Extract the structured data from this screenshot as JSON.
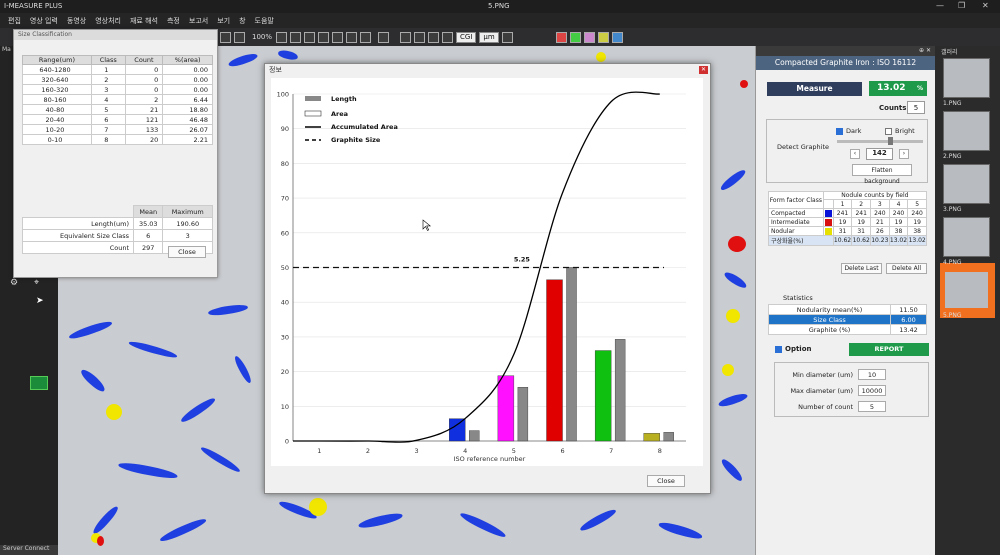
{
  "app": {
    "title": "I-MEASURE PLUS",
    "file": "5.PNG"
  },
  "menu": [
    "편집",
    "영상 입력",
    "동영상",
    "영상처리",
    "재료 해석",
    "측정",
    "보고서",
    "보기",
    "창",
    "도움말"
  ],
  "toolbar": {
    "zoom": "100%",
    "calib": "CGI",
    "unit": "μm"
  },
  "left": {
    "tab_partial": "Ma",
    "server": "Server Connect"
  },
  "size_dialog": {
    "title": "Size Classification",
    "headers": [
      "Range(um)",
      "Class",
      "Count",
      "%(area)"
    ],
    "rows": [
      [
        "640-1280",
        "1",
        "0",
        "0.00"
      ],
      [
        "320-640",
        "2",
        "0",
        "0.00"
      ],
      [
        "160-320",
        "3",
        "0",
        "0.00"
      ],
      [
        "80-160",
        "4",
        "2",
        "6.44"
      ],
      [
        "40-80",
        "5",
        "21",
        "18.80"
      ],
      [
        "20-40",
        "6",
        "121",
        "46.48"
      ],
      [
        "10-20",
        "7",
        "133",
        "26.07"
      ],
      [
        "0-10",
        "8",
        "20",
        "2.21"
      ]
    ],
    "stat_headers": [
      "Mean",
      "Maximum"
    ],
    "stats": [
      {
        "label": "Length(um)",
        "mean": "35.03",
        "max": "190.60"
      },
      {
        "label": "Equivalent Size Class",
        "mean": "6",
        "max": "3"
      },
      {
        "label": "Count",
        "mean": "297",
        "max": ""
      }
    ],
    "close": "Close"
  },
  "right": {
    "panel_title": "Compacted Graphite Iron : ISO 16112",
    "measure": "Measure",
    "value": "13.02",
    "value_unit": "%",
    "counts_label": "Counts",
    "counts": "5",
    "detect": "Detect Graphite",
    "dark": "Dark",
    "bright": "Bright",
    "threshold": "142",
    "flatten": "Flatten background",
    "ff_header": "Form factor Class",
    "nodule_header": "Nodule counts by field",
    "fields": [
      "1",
      "2",
      "3",
      "4",
      "5"
    ],
    "ff_rows": [
      {
        "name": "Compacted",
        "color": "#0a14d8",
        "vals": [
          "241",
          "241",
          "240",
          "240",
          "240"
        ]
      },
      {
        "name": "Intermediate",
        "color": "#d81010",
        "vals": [
          "19",
          "19",
          "21",
          "19",
          "19"
        ]
      },
      {
        "name": "Nodular",
        "color": "#e6e000",
        "vals": [
          "31",
          "31",
          "26",
          "38",
          "38"
        ]
      }
    ],
    "ratio_row": {
      "name": "구상화율(%)",
      "vals": [
        "10.62",
        "10.62",
        "10.23",
        "13.02",
        "13.02"
      ]
    },
    "delete_last": "Delete Last",
    "delete_all": "Delete All",
    "statistics": "Statistics",
    "stat_rows": [
      {
        "label": "Nodularity mean(%)",
        "val": "11.50"
      },
      {
        "label": "Size Class",
        "val": "6.00"
      },
      {
        "label": "Graphite (%)",
        "val": "13.42"
      }
    ],
    "option": "Option",
    "report": "REPORT",
    "options": [
      {
        "label": "Min diameter (um)",
        "val": "10"
      },
      {
        "label": "Max diameter (um)",
        "val": "10000"
      },
      {
        "label": "Number of count",
        "val": "5"
      }
    ]
  },
  "gallery": {
    "title": "갤러리",
    "items": [
      "1.PNG",
      "2.PNG",
      "3.PNG",
      "4.PNG",
      "5.PNG"
    ]
  },
  "chart_dialog": {
    "title": "정보",
    "close": "Close"
  },
  "chart_data": {
    "type": "bar",
    "categories": [
      "1",
      "2",
      "3",
      "4",
      "5",
      "6",
      "7",
      "8"
    ],
    "xlabel": "ISO reference number",
    "ylim": [
      0,
      100
    ],
    "yticks": [
      0,
      10,
      20,
      30,
      40,
      50,
      60,
      70,
      80,
      90,
      100
    ],
    "series": [
      {
        "name": "Area",
        "colors": [
          "#0a14d8",
          "#0a14d8",
          "#0a14d8",
          "#1030e0",
          "#ff10ff",
          "#e00000",
          "#10c010",
          "#b8b020"
        ],
        "values": [
          0,
          0,
          0,
          6.44,
          18.8,
          46.48,
          26.07,
          2.21
        ]
      },
      {
        "name": "Length",
        "color": "#888888",
        "values": [
          0,
          0,
          0,
          3,
          15.5,
          50,
          29.3,
          2.5
        ]
      }
    ],
    "accumulated": [
      0,
      0,
      0.2,
      6.5,
      25,
      71.5,
      97.8,
      100
    ],
    "graphite_size": 50,
    "annotation": "5.25",
    "legend": [
      "Length",
      "Area",
      "Accumulated Area",
      "Graphite Size"
    ]
  }
}
